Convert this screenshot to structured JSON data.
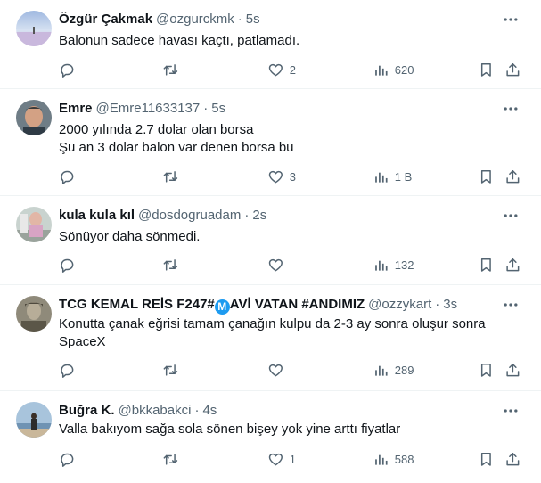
{
  "tweets": [
    {
      "name": "Özgür Çakmak",
      "handle": "@ozgurckmk",
      "time": "5s",
      "lines": [
        "Balonun sadece havası kaçtı, patlamadı."
      ],
      "reply": "",
      "retweet": "",
      "likes": "2",
      "views": "620"
    },
    {
      "name": "Emre",
      "handle": "@Emre11633137",
      "time": "5s",
      "lines": [
        "2000 yılında 2.7 dolar olan borsa",
        "Şu an 3 dolar balon var denen borsa bu"
      ],
      "reply": "",
      "retweet": "",
      "likes": "3",
      "views": "1 B"
    },
    {
      "name": "kula kula kıl",
      "handle": "@dosdogruadam",
      "time": "2s",
      "lines": [
        "Sönüyor daha sönmedi."
      ],
      "reply": "",
      "retweet": "",
      "likes": "",
      "views": "132"
    },
    {
      "name_pre": "TCG KEMAL REİS F247#",
      "name_badge": "M",
      "name_post": "AVİ VATAN #ANDIMIZ",
      "handle": "@ozzykart",
      "time": "3s",
      "lines": [
        "Konutta çanak eğrisi tamam çanağın kulpu da 2-3 ay sonra oluşur sonra",
        "SpaceX"
      ],
      "reply": "",
      "retweet": "",
      "likes": "",
      "views": "289"
    },
    {
      "name": "Buğra K.",
      "handle": "@bkkabakci",
      "time": "4s",
      "lines": [
        "Valla bakıyom sağa sola sönen bişey yok yine arttı fiyatlar"
      ],
      "reply": "",
      "retweet": "",
      "likes": "1",
      "views": "588"
    }
  ],
  "separator": "·",
  "icons": {
    "reply": "reply-icon",
    "retweet": "retweet-icon",
    "like": "heart-icon",
    "views": "views-icon",
    "bookmark": "bookmark-icon",
    "share": "share-icon",
    "more": "more-icon"
  },
  "colors": {
    "text": "#0f1419",
    "muted": "#536471",
    "divider": "#eff3f4",
    "badge": "#1d9bf0"
  }
}
